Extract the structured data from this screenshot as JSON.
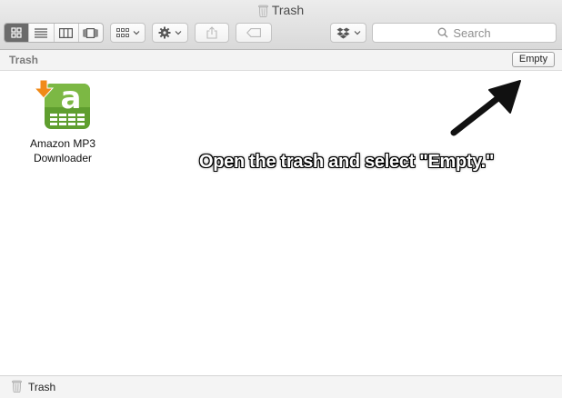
{
  "window": {
    "title": "Trash"
  },
  "toolbar": {
    "view_modes": [
      "icon-view",
      "list-view",
      "column-view",
      "cover-flow-view"
    ],
    "active_view": "icon-view",
    "search_placeholder": "Search"
  },
  "pathbar": {
    "title": "Trash",
    "empty_label": "Empty"
  },
  "files": [
    {
      "name_line1": "Amazon MP3",
      "name_line2": "Downloader",
      "icon": "amazon-mp3-downloader-icon"
    }
  ],
  "annotation": {
    "text": "Open the trash and select \"Empty.\""
  },
  "statusbar": {
    "text": "Trash"
  },
  "colors": {
    "icon_green": "#5f9e2f",
    "icon_orange": "#f08a18",
    "active_segment": "#6b6b6b"
  }
}
